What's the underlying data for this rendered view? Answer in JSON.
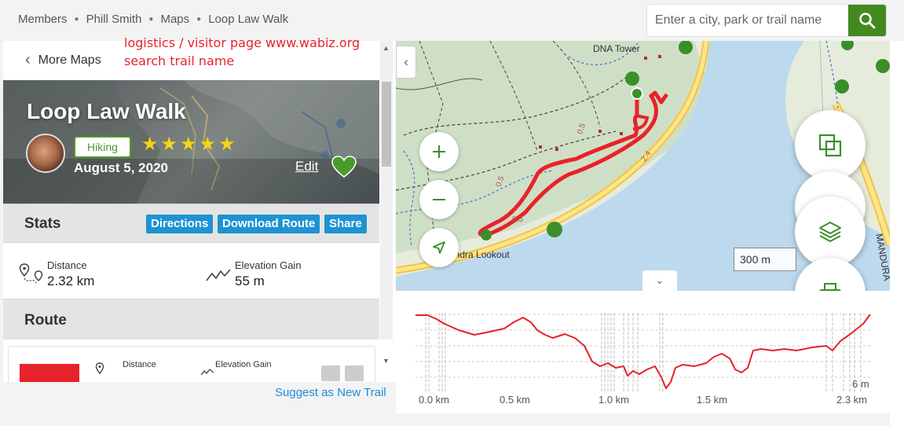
{
  "breadcrumb": [
    "Members",
    "Phill Smith",
    "Maps",
    "Loop Law Walk"
  ],
  "search": {
    "placeholder": "Enter a city, park or trail name"
  },
  "annotation": {
    "line1": "logistics / visitor page www.wabiz.org",
    "line2": "search trail name"
  },
  "panel": {
    "back_label": "More Maps",
    "title": "Loop Law Walk",
    "activity": "Hiking",
    "rating": 5,
    "date": "August 5, 2020",
    "edit_label": "Edit",
    "stats": {
      "heading": "Stats",
      "buttons": [
        "Directions",
        "Download Route",
        "Share"
      ],
      "distance_label": "Distance",
      "distance_value": "2.32 km",
      "elevation_label": "Elevation Gain",
      "elevation_value": "55 m"
    },
    "route": {
      "heading": "Route",
      "item_distance_label": "Distance",
      "item_elevation_label": "Elevation Gain"
    },
    "suggest_label": "Suggest as New Trail"
  },
  "map": {
    "labels": {
      "tower": "DNA Tower",
      "lookout": "yandra Lookout",
      "road": "MANDURA",
      "dist_a": "0.5",
      "dist_b": "0.5",
      "dist_c": "0.5",
      "dist_d": "2.4"
    },
    "scale": "300 m"
  },
  "elevation": {
    "ticks": [
      "0.0 km",
      "0.5 km",
      "1.0 km",
      "1.5 km",
      "2.3 km"
    ],
    "unit": "6 m"
  },
  "colors": {
    "brand_green": "#428a1e",
    "link_blue": "#1d93d2",
    "route_red": "#e8222a"
  }
}
